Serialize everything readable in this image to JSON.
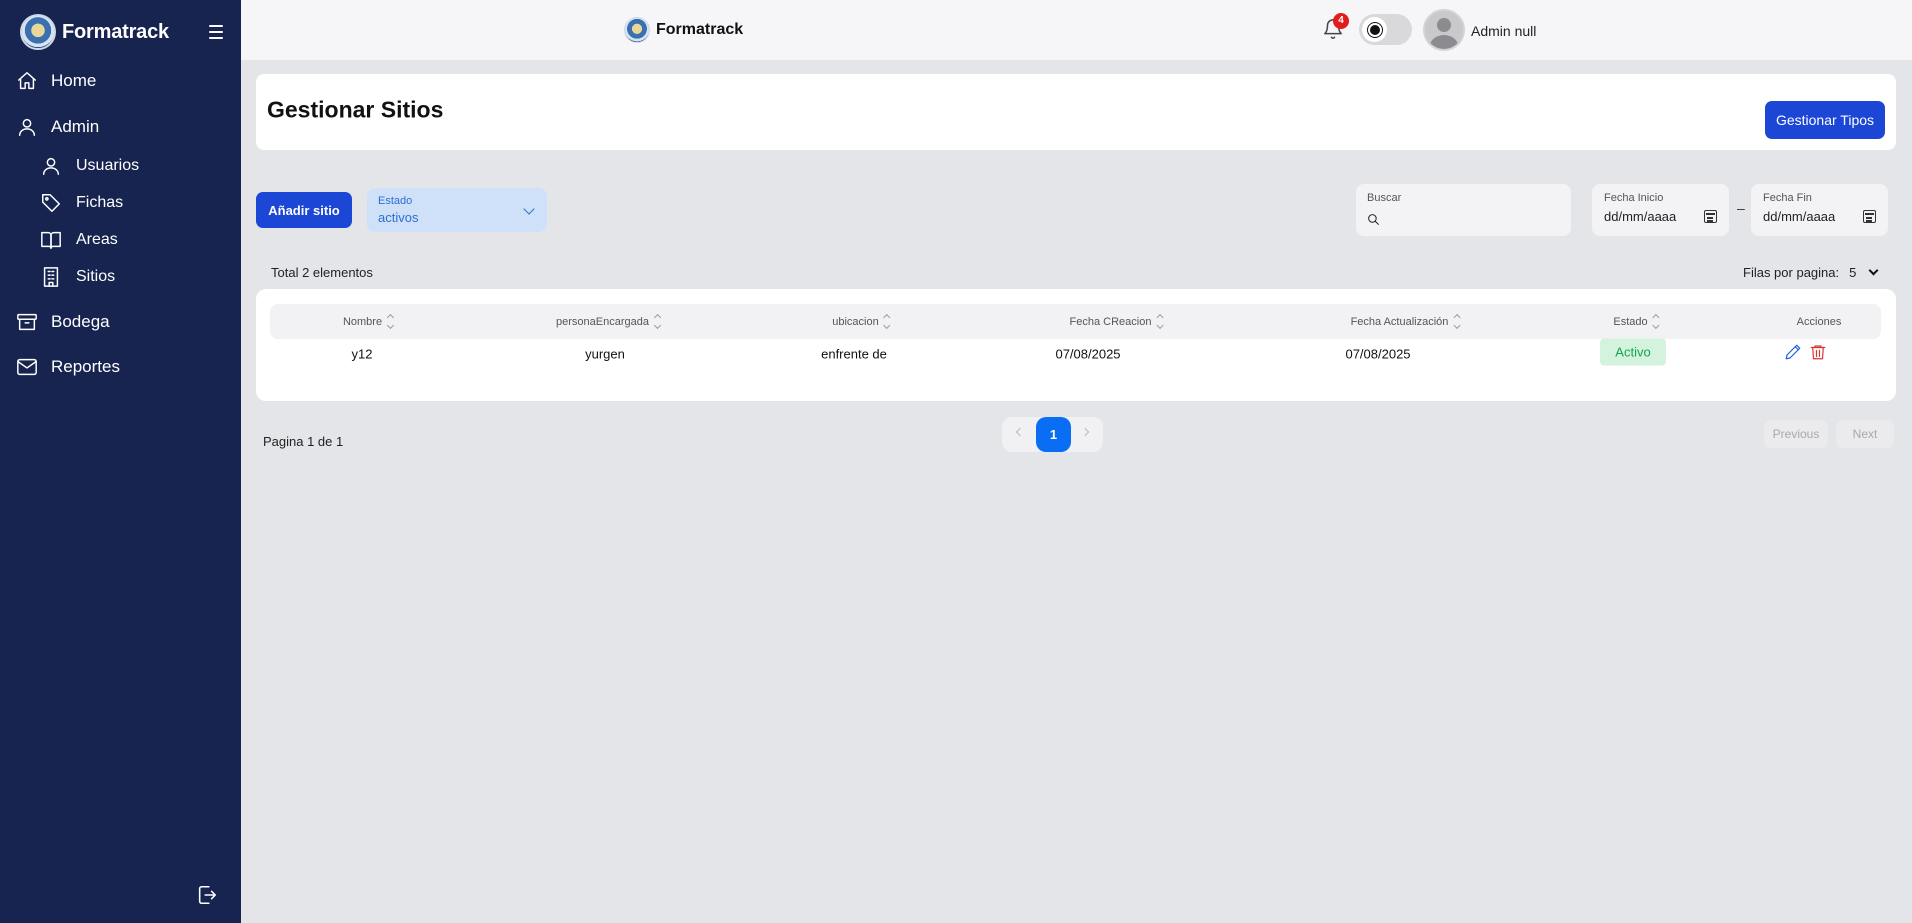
{
  "app": {
    "name": "Formatrack"
  },
  "sidebar": {
    "items": [
      {
        "label": "Home",
        "icon": "home-icon"
      },
      {
        "label": "Admin",
        "icon": "user-icon"
      },
      {
        "label": "Usuarios",
        "icon": "user-icon"
      },
      {
        "label": "Fichas",
        "icon": "tag-icon"
      },
      {
        "label": "Areas",
        "icon": "book-icon"
      },
      {
        "label": "Sitios",
        "icon": "building-icon"
      },
      {
        "label": "Bodega",
        "icon": "archive-icon"
      },
      {
        "label": "Reportes",
        "icon": "mail-icon"
      }
    ]
  },
  "topbar": {
    "brand": "Formatrack",
    "notification_count": "4",
    "user_name": "Admin null"
  },
  "page": {
    "title": "Gestionar Sitios",
    "manage_types_label": "Gestionar Tipos",
    "add_label": "Añadir sitio"
  },
  "filters": {
    "estado_label": "Estado",
    "estado_value": "activos",
    "search_label": "Buscar",
    "search_value": "",
    "fecha_inicio_label": "Fecha Inicio",
    "fecha_inicio_placeholder": "dd/mm/aaaa",
    "fecha_fin_label": "Fecha Fin",
    "fecha_fin_placeholder": "dd/mm/aaaa",
    "dash": "–"
  },
  "table": {
    "total_text": "Total 2 elementos",
    "rows_per_page_label": "Filas por pagina:",
    "rows_per_page_value": "5",
    "columns": [
      "Nombre",
      "personaEncargada",
      "ubicacion",
      "Fecha CReacion",
      "Fecha Actualización",
      "Estado",
      "Acciones"
    ],
    "rows": [
      {
        "nombre": "y12",
        "persona": "yurgen",
        "ubicacion": "enfrente de",
        "fecha_creacion": "07/08/2025",
        "fecha_actualizacion": "07/08/2025",
        "estado": "Activo"
      }
    ]
  },
  "pagination": {
    "info": "Pagina 1 de 1",
    "current_page": "1",
    "previous_label": "Previous",
    "next_label": "Next"
  },
  "colors": {
    "sidebar_bg": "#172450",
    "primary": "#1c46d6",
    "page_active": "#0a6ef5",
    "status_active": "#17a34a",
    "delete": "#e03131"
  }
}
